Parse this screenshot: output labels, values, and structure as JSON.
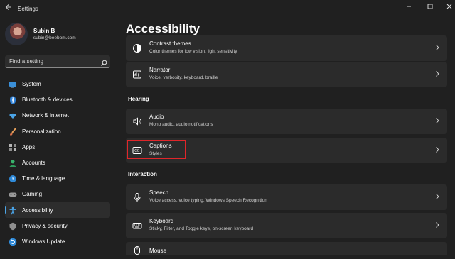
{
  "window": {
    "title": "Settings",
    "controls": [
      "minimize-icon",
      "maximize-icon",
      "close-icon"
    ]
  },
  "profile": {
    "name": "Subin B",
    "email": "subin@beebom.com"
  },
  "search": {
    "placeholder": "Find a setting"
  },
  "sidebar": {
    "items": [
      {
        "label": "System",
        "icon": "monitor-icon"
      },
      {
        "label": "Bluetooth & devices",
        "icon": "bluetooth-icon"
      },
      {
        "label": "Network & internet",
        "icon": "wifi-icon"
      },
      {
        "label": "Personalization",
        "icon": "brush-icon"
      },
      {
        "label": "Apps",
        "icon": "apps-icon"
      },
      {
        "label": "Accounts",
        "icon": "person-icon"
      },
      {
        "label": "Time & language",
        "icon": "globe-clock-icon"
      },
      {
        "label": "Gaming",
        "icon": "gamepad-icon"
      },
      {
        "label": "Accessibility",
        "icon": "accessibility-icon",
        "selected": true
      },
      {
        "label": "Privacy & security",
        "icon": "shield-icon"
      },
      {
        "label": "Windows Update",
        "icon": "update-icon"
      }
    ]
  },
  "main": {
    "title": "Accessibility",
    "cards": [
      {
        "title": "Contrast themes",
        "subtitle": "Color themes for low vision, light sensitivity",
        "icon": "contrast-icon"
      },
      {
        "title": "Narrator",
        "subtitle": "Voice, verbosity, keyboard, braille",
        "icon": "narrator-icon"
      },
      {
        "title": "Audio",
        "subtitle": "Mono audio, audio notifications",
        "icon": "speaker-icon"
      },
      {
        "title": "Captions",
        "subtitle": "Styles",
        "icon": "captions-icon"
      },
      {
        "title": "Speech",
        "subtitle": "Voice access, voice typing, Windows Speech Recognition",
        "icon": "microphone-icon"
      },
      {
        "title": "Keyboard",
        "subtitle": "Sticky, Filter, and Toggle keys, on-screen keyboard",
        "icon": "keyboard-icon"
      },
      {
        "title": "Mouse",
        "subtitle": "",
        "icon": "mouse-icon"
      }
    ],
    "sections": {
      "hearing": "Hearing",
      "interaction": "Interaction"
    }
  },
  "colors": {
    "background": "#202020",
    "card": "#2b2b2b",
    "accent": "#4ca6e8",
    "highlight": "#e0262a"
  }
}
